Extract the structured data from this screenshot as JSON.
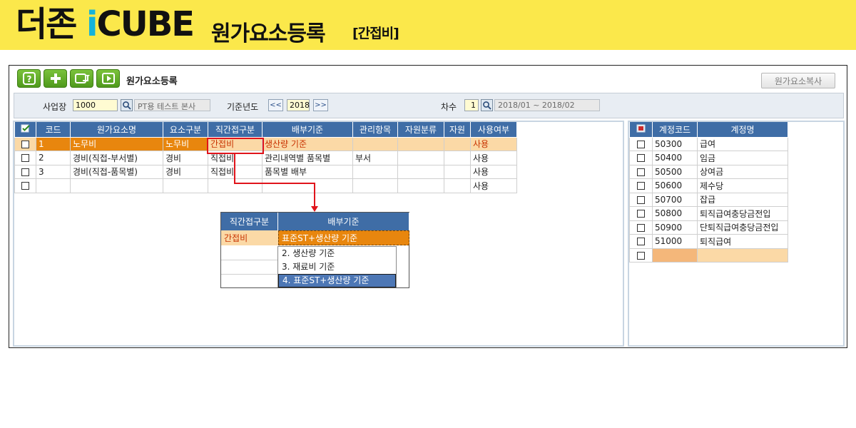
{
  "banner": {
    "brand_prefix": "더존",
    "brand_ic": "i",
    "brand_cube": "CUBE",
    "heading": "원가요소등록",
    "subheading": "[간접비]"
  },
  "window": {
    "title": "원가요소등록",
    "copy_button": "원가요소복사",
    "toolbar_icons": [
      "help-icon",
      "add-icon",
      "refresh-icon",
      "play-icon"
    ]
  },
  "filter": {
    "site_label": "사업장",
    "site_code": "1000",
    "site_name": "PT용 테스트 본사",
    "year_label": "기준년도",
    "prev": "<<",
    "year": "2018",
    "next": ">>",
    "seq_label": "차수",
    "seq": "1",
    "period": "2018/01 ~ 2018/02"
  },
  "left_grid": {
    "headers": [
      "코드",
      "원가요소명",
      "요소구분",
      "직간접구분",
      "배부기준",
      "관리항목",
      "자원분류",
      "자원",
      "사용여부"
    ],
    "rows": [
      {
        "code": "1",
        "name": "노무비",
        "type": "노무비",
        "direct": "간접비",
        "basis": "생산량 기준",
        "item": "",
        "res_cls": "",
        "res": "",
        "use": "사용"
      },
      {
        "code": "2",
        "name": "경비(직접-부서별)",
        "type": "경비",
        "direct": "직접비",
        "basis": "관리내역별 품목별",
        "item": "부서",
        "res_cls": "",
        "res": "",
        "use": "사용"
      },
      {
        "code": "3",
        "name": "경비(직접-품목별)",
        "type": "경비",
        "direct": "직접비",
        "basis": "품목별 배부",
        "item": "",
        "res_cls": "",
        "res": "",
        "use": "사용"
      },
      {
        "code": "",
        "name": "",
        "type": "",
        "direct": "",
        "basis": "",
        "item": "",
        "res_cls": "",
        "res": "",
        "use": "사용"
      }
    ]
  },
  "zoom": {
    "h1": "직간접구분",
    "h2": "배부기준",
    "direct": "간접비",
    "basis": "표준ST+생산량 기준",
    "options": [
      "2. 생산량 기준",
      "3. 재료비 기준",
      "4. 표준ST+생산량 기준"
    ]
  },
  "right_grid": {
    "headers": [
      "계정코드",
      "계정명"
    ],
    "rows": [
      {
        "code": "50300",
        "name": "급여"
      },
      {
        "code": "50400",
        "name": "임금"
      },
      {
        "code": "50500",
        "name": "상여금"
      },
      {
        "code": "50600",
        "name": "제수당"
      },
      {
        "code": "50700",
        "name": "잡급"
      },
      {
        "code": "50800",
        "name": "퇴직급여충당금전입"
      },
      {
        "code": "50900",
        "name": "단퇴직급여충당금전입"
      },
      {
        "code": "51000",
        "name": "퇴직급여"
      },
      {
        "code": "",
        "name": ""
      }
    ]
  },
  "colors": {
    "banner": "#fbe84b",
    "brand_accent": "#14b3d9",
    "grid_header": "#3f6da6",
    "selected_row": "#fbd9a6",
    "selected_cell": "#e8860e",
    "annotation_red": "#e0141b"
  }
}
